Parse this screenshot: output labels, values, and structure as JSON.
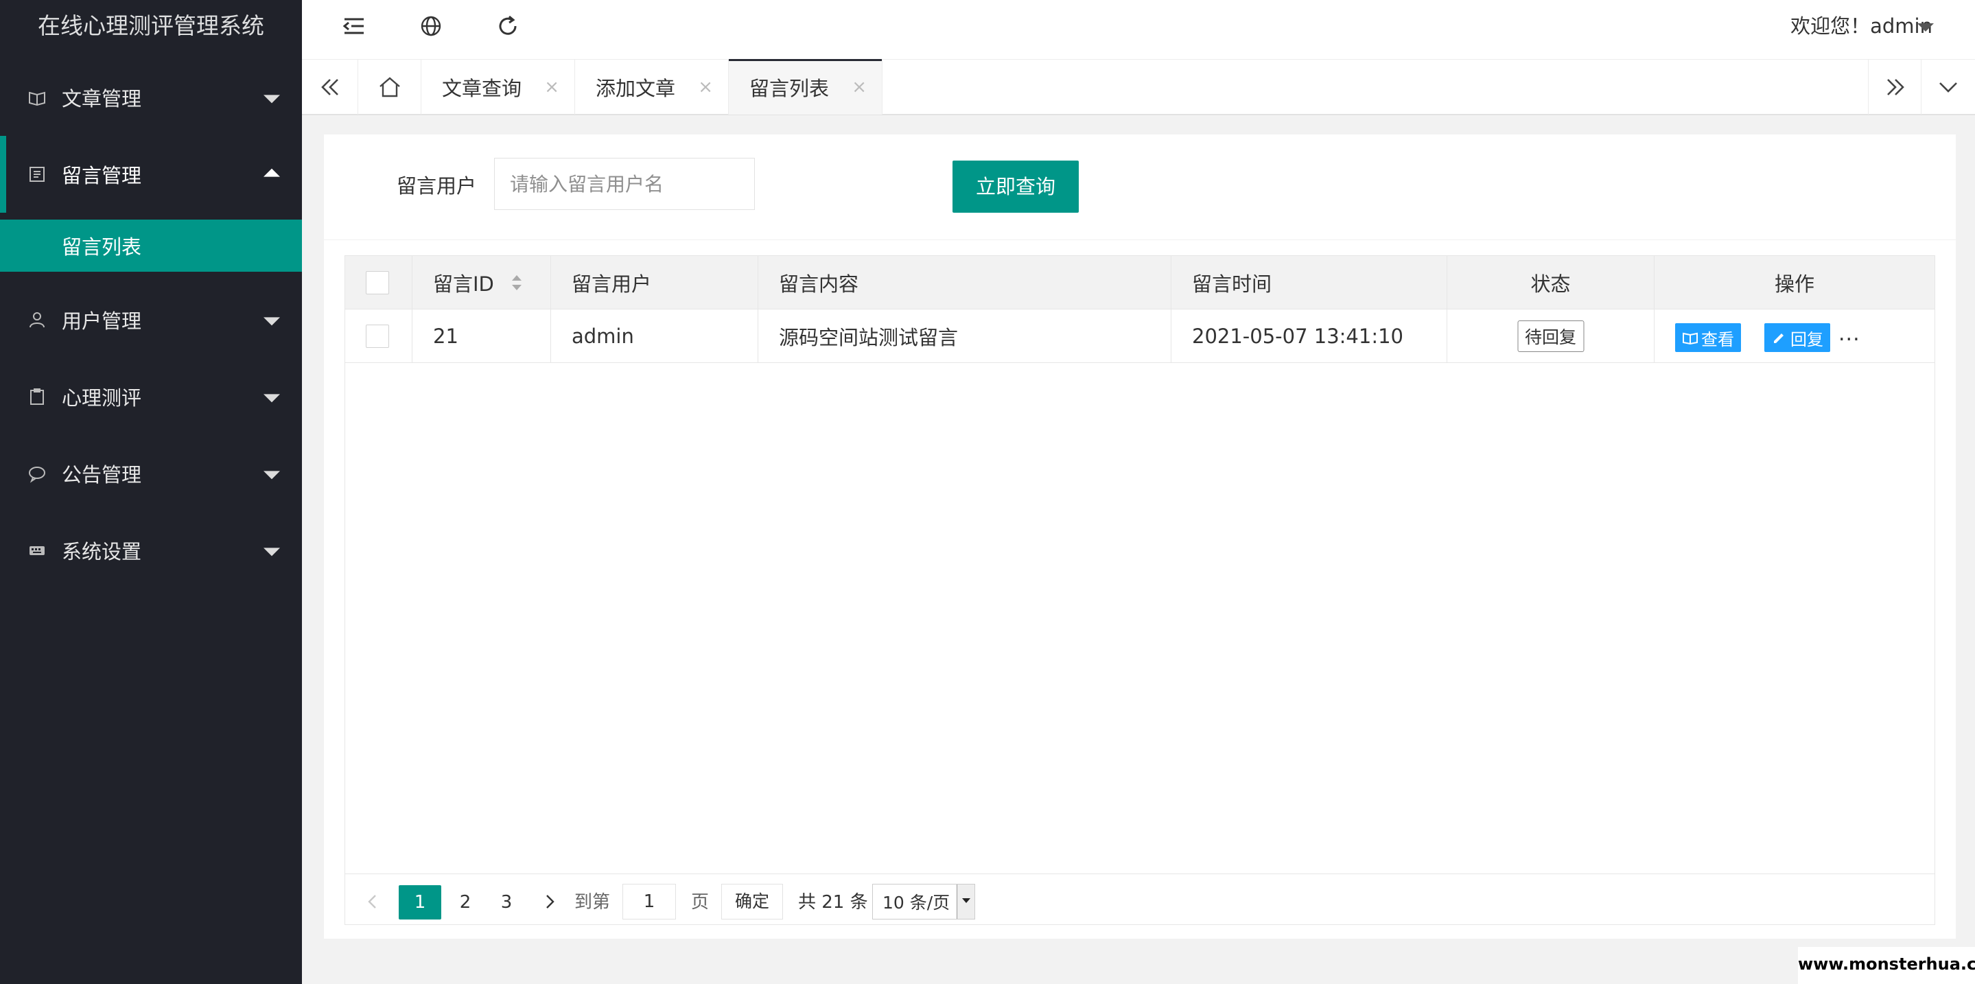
{
  "app": {
    "title": "在线心理测评管理系统"
  },
  "sidebar": {
    "items": [
      {
        "label": "文章管理",
        "icon": "book-icon",
        "expanded": false
      },
      {
        "label": "留言管理",
        "icon": "message-icon",
        "expanded": true,
        "children": [
          {
            "label": "留言列表",
            "active": true
          }
        ]
      },
      {
        "label": "用户管理",
        "icon": "user-icon",
        "expanded": false
      },
      {
        "label": "心理测评",
        "icon": "clipboard-icon",
        "expanded": false
      },
      {
        "label": "公告管理",
        "icon": "bubble-icon",
        "expanded": false
      },
      {
        "label": "系统设置",
        "icon": "keyboard-icon",
        "expanded": false
      }
    ]
  },
  "header": {
    "icons": [
      "menu-collapse-icon",
      "globe-icon",
      "refresh-icon"
    ],
    "welcome": "欢迎您！admin"
  },
  "tabs": {
    "items": [
      {
        "label": "文章查询",
        "active": false
      },
      {
        "label": "添加文章",
        "active": false
      },
      {
        "label": "留言列表",
        "active": true
      }
    ],
    "close_glyph": "×"
  },
  "search": {
    "label": "留言用户",
    "placeholder": "请输入留言用户名",
    "value": "",
    "button": "立即查询"
  },
  "table": {
    "columns": [
      "留言ID",
      "留言用户",
      "留言内容",
      "留言时间",
      "状态",
      "操作"
    ],
    "rows": [
      {
        "id": "21",
        "user": "admin",
        "content": "源码空间站测试留言",
        "time": "2021-05-07 13:41:10",
        "status": "待回复",
        "actions": [
          "查看",
          "回复"
        ],
        "more": "..."
      }
    ]
  },
  "pagination": {
    "pages": [
      "1",
      "2",
      "3"
    ],
    "current": "1",
    "goto_label": "到第",
    "goto_value": "1",
    "page_unit": "页",
    "confirm": "确定",
    "total": "共 21 条",
    "page_size": "10 条/页"
  },
  "watermark": "www.monsterhua.com",
  "colors": {
    "sidebar_bg": "#20222a",
    "accent": "#009688",
    "action_blue": "#1e9fff",
    "page_bg": "#f2f2f2"
  }
}
